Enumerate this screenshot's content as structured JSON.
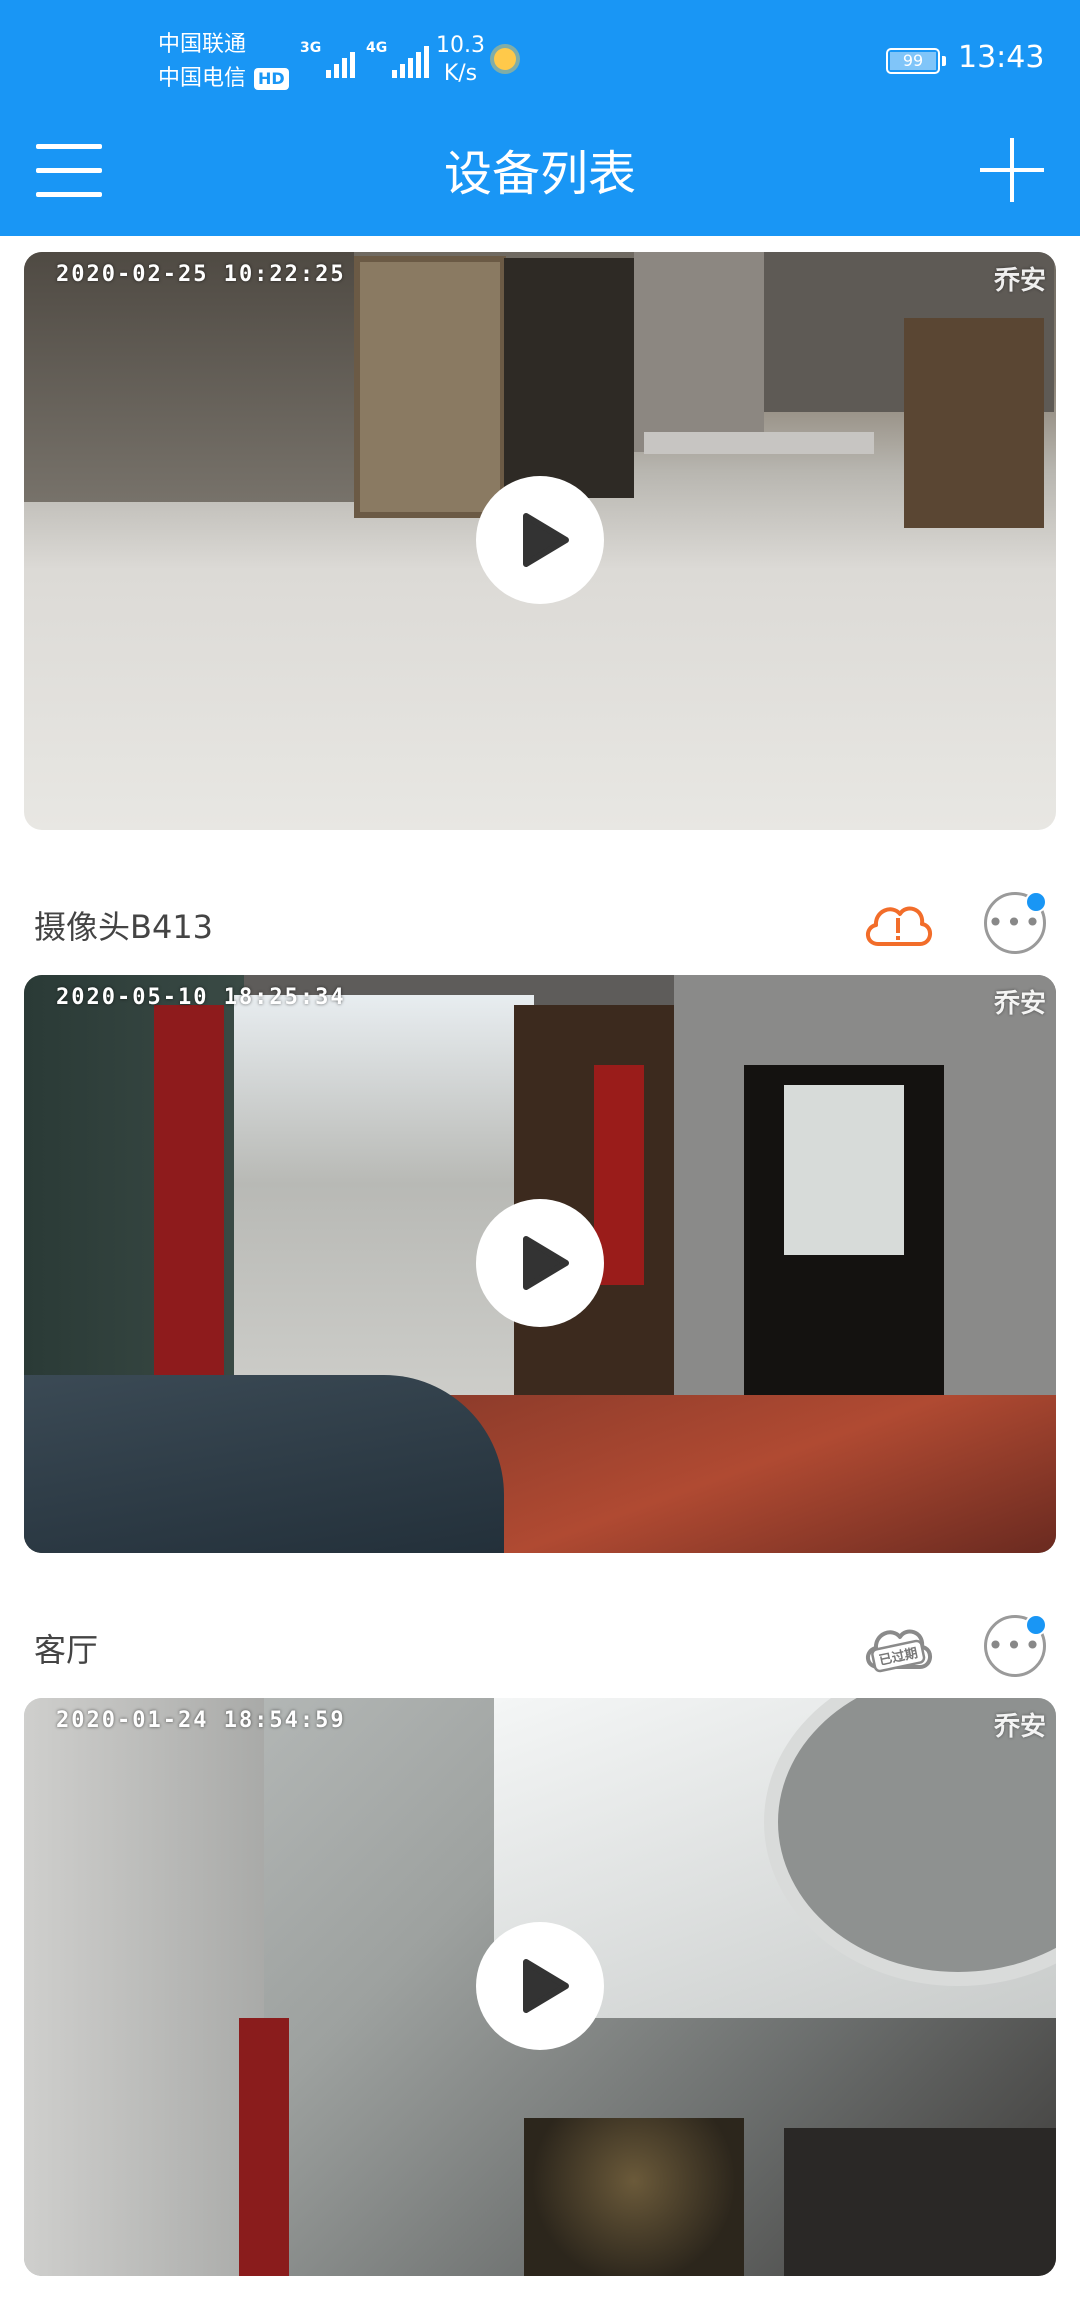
{
  "status_bar": {
    "carrier1": "中国联通",
    "carrier2": "中国电信",
    "hd": "HD",
    "net1": "3G",
    "net2": "4G",
    "speed_value": "10.3",
    "speed_unit": "K/s",
    "battery": "99",
    "time": "13:43"
  },
  "app_bar": {
    "title": "设备列表",
    "menu_icon": "menu-icon",
    "add_icon": "add-icon"
  },
  "devices": [
    {
      "timestamp": "2020-02-25 10:22:25",
      "brand": "乔安"
    },
    {
      "name": "摄像头B413",
      "timestamp": "2020-05-10 18:25:34",
      "brand": "乔安",
      "cloud_icon": "cloud-alert-icon",
      "cloud_color": "#f26d2a"
    },
    {
      "name": "客厅",
      "timestamp": "2020-01-24 18:54:59",
      "brand": "乔安",
      "cloud_icon": "cloud-expired-icon",
      "cloud_label": "已过期"
    }
  ],
  "colors": {
    "primary": "#1996f5",
    "alert": "#f26d2a"
  }
}
